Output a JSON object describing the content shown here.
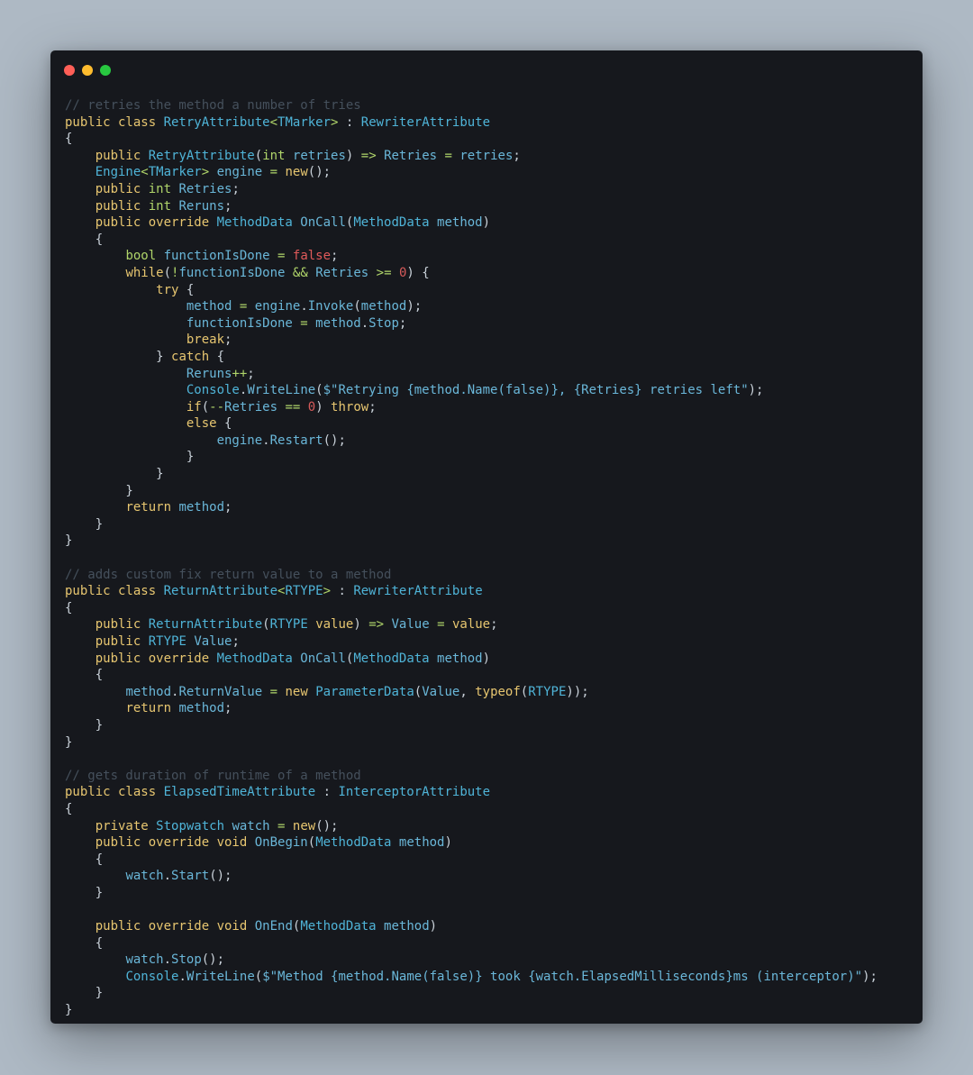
{
  "window": {
    "controls": [
      "close",
      "minimize",
      "maximize"
    ]
  },
  "code": {
    "lines": [
      [
        [
          "comment",
          "// retries the method a number of tries"
        ]
      ],
      [
        [
          "keyword",
          "public class "
        ],
        [
          "type",
          "RetryAttribute"
        ],
        [
          "op",
          "<"
        ],
        [
          "type",
          "TMarker"
        ],
        [
          "op",
          "> "
        ],
        [
          "plain",
          ": "
        ],
        [
          "type",
          "RewriterAttribute"
        ]
      ],
      [
        [
          "plain",
          "{"
        ]
      ],
      [
        [
          "plain",
          "    "
        ],
        [
          "keyword",
          "public "
        ],
        [
          "type",
          "RetryAttribute"
        ],
        [
          "plain",
          "("
        ],
        [
          "kwgreen",
          "int "
        ],
        [
          "ident",
          "retries"
        ],
        [
          "plain",
          ") "
        ],
        [
          "op",
          "=> "
        ],
        [
          "ident",
          "Retries "
        ],
        [
          "op",
          "= "
        ],
        [
          "ident",
          "retries"
        ],
        [
          "plain",
          ";"
        ]
      ],
      [
        [
          "plain",
          "    "
        ],
        [
          "type",
          "Engine"
        ],
        [
          "op",
          "<"
        ],
        [
          "type",
          "TMarker"
        ],
        [
          "op",
          "> "
        ],
        [
          "ident",
          "engine "
        ],
        [
          "op",
          "= "
        ],
        [
          "keyword",
          "new"
        ],
        [
          "plain",
          "();"
        ]
      ],
      [
        [
          "plain",
          "    "
        ],
        [
          "keyword",
          "public "
        ],
        [
          "kwgreen",
          "int "
        ],
        [
          "ident",
          "Retries"
        ],
        [
          "plain",
          ";"
        ]
      ],
      [
        [
          "plain",
          "    "
        ],
        [
          "keyword",
          "public "
        ],
        [
          "kwgreen",
          "int "
        ],
        [
          "ident",
          "Reruns"
        ],
        [
          "plain",
          ";"
        ]
      ],
      [
        [
          "plain",
          "    "
        ],
        [
          "keyword",
          "public override "
        ],
        [
          "type",
          "MethodData "
        ],
        [
          "ident",
          "OnCall"
        ],
        [
          "plain",
          "("
        ],
        [
          "type",
          "MethodData "
        ],
        [
          "ident",
          "method"
        ],
        [
          "plain",
          ")"
        ]
      ],
      [
        [
          "plain",
          "    {"
        ]
      ],
      [
        [
          "plain",
          "        "
        ],
        [
          "kwgreen",
          "bool "
        ],
        [
          "ident",
          "functionIsDone "
        ],
        [
          "op",
          "= "
        ],
        [
          "bool",
          "false"
        ],
        [
          "plain",
          ";"
        ]
      ],
      [
        [
          "plain",
          "        "
        ],
        [
          "keyword",
          "while"
        ],
        [
          "plain",
          "("
        ],
        [
          "op",
          "!"
        ],
        [
          "ident",
          "functionIsDone "
        ],
        [
          "op",
          "&& "
        ],
        [
          "ident",
          "Retries "
        ],
        [
          "op",
          ">= "
        ],
        [
          "number",
          "0"
        ],
        [
          "plain",
          ") {"
        ]
      ],
      [
        [
          "plain",
          "            "
        ],
        [
          "keyword",
          "try "
        ],
        [
          "plain",
          "{"
        ]
      ],
      [
        [
          "plain",
          "                "
        ],
        [
          "ident",
          "method "
        ],
        [
          "op",
          "= "
        ],
        [
          "ident",
          "engine"
        ],
        [
          "plain",
          "."
        ],
        [
          "ident",
          "Invoke"
        ],
        [
          "plain",
          "("
        ],
        [
          "ident",
          "method"
        ],
        [
          "plain",
          ");"
        ]
      ],
      [
        [
          "plain",
          "                "
        ],
        [
          "ident",
          "functionIsDone "
        ],
        [
          "op",
          "= "
        ],
        [
          "ident",
          "method"
        ],
        [
          "plain",
          "."
        ],
        [
          "ident",
          "Stop"
        ],
        [
          "plain",
          ";"
        ]
      ],
      [
        [
          "plain",
          "                "
        ],
        [
          "keyword",
          "break"
        ],
        [
          "plain",
          ";"
        ]
      ],
      [
        [
          "plain",
          "            } "
        ],
        [
          "keyword",
          "catch "
        ],
        [
          "plain",
          "{"
        ]
      ],
      [
        [
          "plain",
          "                "
        ],
        [
          "ident",
          "Reruns"
        ],
        [
          "op",
          "++"
        ],
        [
          "plain",
          ";"
        ]
      ],
      [
        [
          "plain",
          "                "
        ],
        [
          "type",
          "Console"
        ],
        [
          "plain",
          "."
        ],
        [
          "ident",
          "WriteLine"
        ],
        [
          "plain",
          "("
        ],
        [
          "string",
          "$\"Retrying {method.Name(false)}, {Retries} retries left\""
        ],
        [
          "plain",
          ");"
        ]
      ],
      [
        [
          "plain",
          "                "
        ],
        [
          "keyword",
          "if"
        ],
        [
          "plain",
          "("
        ],
        [
          "op",
          "--"
        ],
        [
          "ident",
          "Retries "
        ],
        [
          "op",
          "== "
        ],
        [
          "number",
          "0"
        ],
        [
          "plain",
          ") "
        ],
        [
          "keyword",
          "throw"
        ],
        [
          "plain",
          ";"
        ]
      ],
      [
        [
          "plain",
          "                "
        ],
        [
          "keyword",
          "else "
        ],
        [
          "plain",
          "{"
        ]
      ],
      [
        [
          "plain",
          "                    "
        ],
        [
          "ident",
          "engine"
        ],
        [
          "plain",
          "."
        ],
        [
          "ident",
          "Restart"
        ],
        [
          "plain",
          "();"
        ]
      ],
      [
        [
          "plain",
          "                }"
        ]
      ],
      [
        [
          "plain",
          "            }"
        ]
      ],
      [
        [
          "plain",
          "        }"
        ]
      ],
      [
        [
          "plain",
          "        "
        ],
        [
          "keyword",
          "return "
        ],
        [
          "ident",
          "method"
        ],
        [
          "plain",
          ";"
        ]
      ],
      [
        [
          "plain",
          "    }"
        ]
      ],
      [
        [
          "plain",
          "}"
        ]
      ],
      [
        [
          "plain",
          ""
        ]
      ],
      [
        [
          "comment",
          "// adds custom fix return value to a method"
        ]
      ],
      [
        [
          "keyword",
          "public class "
        ],
        [
          "type",
          "ReturnAttribute"
        ],
        [
          "op",
          "<"
        ],
        [
          "type",
          "RTYPE"
        ],
        [
          "op",
          "> "
        ],
        [
          "plain",
          ": "
        ],
        [
          "type",
          "RewriterAttribute"
        ]
      ],
      [
        [
          "plain",
          "{"
        ]
      ],
      [
        [
          "plain",
          "    "
        ],
        [
          "keyword",
          "public "
        ],
        [
          "type",
          "ReturnAttribute"
        ],
        [
          "plain",
          "("
        ],
        [
          "type",
          "RTYPE "
        ],
        [
          "keyword",
          "value"
        ],
        [
          "plain",
          ") "
        ],
        [
          "op",
          "=> "
        ],
        [
          "ident",
          "Value "
        ],
        [
          "op",
          "= "
        ],
        [
          "keyword",
          "value"
        ],
        [
          "plain",
          ";"
        ]
      ],
      [
        [
          "plain",
          "    "
        ],
        [
          "keyword",
          "public "
        ],
        [
          "type",
          "RTYPE "
        ],
        [
          "ident",
          "Value"
        ],
        [
          "plain",
          ";"
        ]
      ],
      [
        [
          "plain",
          "    "
        ],
        [
          "keyword",
          "public override "
        ],
        [
          "type",
          "MethodData "
        ],
        [
          "ident",
          "OnCall"
        ],
        [
          "plain",
          "("
        ],
        [
          "type",
          "MethodData "
        ],
        [
          "ident",
          "method"
        ],
        [
          "plain",
          ")"
        ]
      ],
      [
        [
          "plain",
          "    {"
        ]
      ],
      [
        [
          "plain",
          "        "
        ],
        [
          "ident",
          "method"
        ],
        [
          "plain",
          "."
        ],
        [
          "ident",
          "ReturnValue "
        ],
        [
          "op",
          "= "
        ],
        [
          "keyword",
          "new "
        ],
        [
          "type",
          "ParameterData"
        ],
        [
          "plain",
          "("
        ],
        [
          "ident",
          "Value"
        ],
        [
          "plain",
          ", "
        ],
        [
          "keyword",
          "typeof"
        ],
        [
          "plain",
          "("
        ],
        [
          "type",
          "RTYPE"
        ],
        [
          "plain",
          "));"
        ]
      ],
      [
        [
          "plain",
          "        "
        ],
        [
          "keyword",
          "return "
        ],
        [
          "ident",
          "method"
        ],
        [
          "plain",
          ";"
        ]
      ],
      [
        [
          "plain",
          "    }"
        ]
      ],
      [
        [
          "plain",
          "}"
        ]
      ],
      [
        [
          "plain",
          ""
        ]
      ],
      [
        [
          "comment",
          "// gets duration of runtime of a method"
        ]
      ],
      [
        [
          "keyword",
          "public class "
        ],
        [
          "type",
          "ElapsedTimeAttribute "
        ],
        [
          "plain",
          ": "
        ],
        [
          "type",
          "InterceptorAttribute"
        ]
      ],
      [
        [
          "plain",
          "{"
        ]
      ],
      [
        [
          "plain",
          "    "
        ],
        [
          "keyword",
          "private "
        ],
        [
          "type",
          "Stopwatch "
        ],
        [
          "ident",
          "watch "
        ],
        [
          "op",
          "= "
        ],
        [
          "keyword",
          "new"
        ],
        [
          "plain",
          "();"
        ]
      ],
      [
        [
          "plain",
          "    "
        ],
        [
          "keyword",
          "public override void "
        ],
        [
          "ident",
          "OnBegin"
        ],
        [
          "plain",
          "("
        ],
        [
          "type",
          "MethodData "
        ],
        [
          "ident",
          "method"
        ],
        [
          "plain",
          ")"
        ]
      ],
      [
        [
          "plain",
          "    {"
        ]
      ],
      [
        [
          "plain",
          "        "
        ],
        [
          "ident",
          "watch"
        ],
        [
          "plain",
          "."
        ],
        [
          "ident",
          "Start"
        ],
        [
          "plain",
          "();"
        ]
      ],
      [
        [
          "plain",
          "    }"
        ]
      ],
      [
        [
          "plain",
          ""
        ]
      ],
      [
        [
          "plain",
          "    "
        ],
        [
          "keyword",
          "public override void "
        ],
        [
          "ident",
          "OnEnd"
        ],
        [
          "plain",
          "("
        ],
        [
          "type",
          "MethodData "
        ],
        [
          "ident",
          "method"
        ],
        [
          "plain",
          ")"
        ]
      ],
      [
        [
          "plain",
          "    {"
        ]
      ],
      [
        [
          "plain",
          "        "
        ],
        [
          "ident",
          "watch"
        ],
        [
          "plain",
          "."
        ],
        [
          "ident",
          "Stop"
        ],
        [
          "plain",
          "();"
        ]
      ],
      [
        [
          "plain",
          "        "
        ],
        [
          "type",
          "Console"
        ],
        [
          "plain",
          "."
        ],
        [
          "ident",
          "WriteLine"
        ],
        [
          "plain",
          "("
        ],
        [
          "string",
          "$\"Method {method.Name(false)} took {watch.ElapsedMilliseconds}ms (interceptor)\""
        ],
        [
          "plain",
          ");"
        ]
      ],
      [
        [
          "plain",
          "    }"
        ]
      ],
      [
        [
          "plain",
          "}"
        ]
      ]
    ]
  }
}
